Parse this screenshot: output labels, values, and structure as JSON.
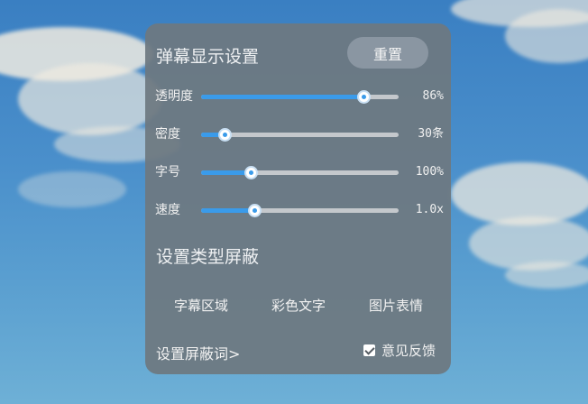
{
  "panel": {
    "title": "弹幕显示设置",
    "reset_label": "重置"
  },
  "sliders": [
    {
      "label": "透明度",
      "value_text": "86%",
      "level": 0.82
    },
    {
      "label": "密度",
      "value_text": "30条",
      "level": 0.12
    },
    {
      "label": "字号",
      "value_text": "100%",
      "level": 0.25
    },
    {
      "label": "速度",
      "value_text": "1.0x",
      "level": 0.27
    }
  ],
  "block_types": {
    "title": "设置类型屏蔽",
    "items": [
      "字幕区域",
      "彩色文字",
      "图片表情"
    ]
  },
  "footer": {
    "block_words_label": "设置屏蔽词>",
    "feedback_label": "意见反馈",
    "feedback_checked": true
  },
  "colors": {
    "accent": "#3a9bea",
    "panel_bg": "#6e7880"
  }
}
